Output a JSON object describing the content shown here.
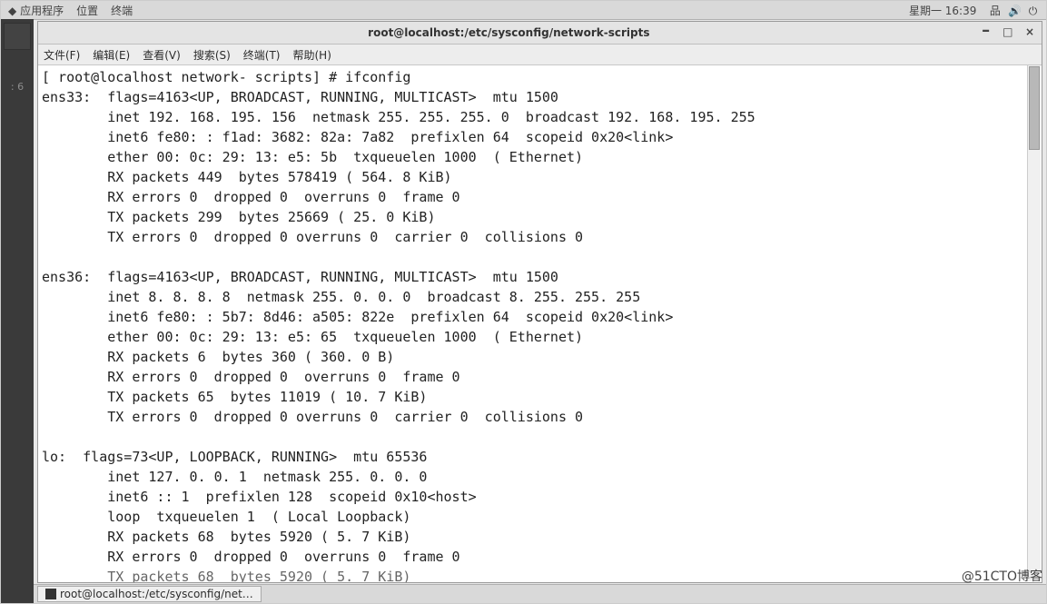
{
  "top_panel": {
    "apps": "应用程序",
    "places": "位置",
    "terminal": "终端",
    "clock": "星期一 16:39"
  },
  "left_clock": ": 6",
  "window": {
    "title": "root@localhost:/etc/sysconfig/network-scripts",
    "btn_min": "–",
    "btn_max": "□",
    "btn_close": "×"
  },
  "menubar": {
    "file": "文件(F)",
    "edit": "编辑(E)",
    "view": "查看(V)",
    "search": "搜索(S)",
    "terminal": "终端(T)",
    "help": "帮助(H)"
  },
  "term": {
    "l01": "[ root@localhost network- scripts] # ifconfig",
    "l02": "ens33:  flags=4163<UP, BROADCAST, RUNNING, MULTICAST>  mtu 1500",
    "l03": "        inet 192. 168. 195. 156  netmask 255. 255. 255. 0  broadcast 192. 168. 195. 255",
    "l04": "        inet6 fe80: : f1ad: 3682: 82a: 7a82  prefixlen 64  scopeid 0x20<link>",
    "l05": "        ether 00: 0c: 29: 13: e5: 5b  txqueuelen 1000  ( Ethernet)",
    "l06": "        RX packets 449  bytes 578419 ( 564. 8 KiB)",
    "l07": "        RX errors 0  dropped 0  overruns 0  frame 0",
    "l08": "        TX packets 299  bytes 25669 ( 25. 0 KiB)",
    "l09": "        TX errors 0  dropped 0 overruns 0  carrier 0  collisions 0",
    "l10": "",
    "l11": "ens36:  flags=4163<UP, BROADCAST, RUNNING, MULTICAST>  mtu 1500",
    "l12": "        inet 8. 8. 8. 8  netmask 255. 0. 0. 0  broadcast 8. 255. 255. 255",
    "l13": "        inet6 fe80: : 5b7: 8d46: a505: 822e  prefixlen 64  scopeid 0x20<link>",
    "l14": "        ether 00: 0c: 29: 13: e5: 65  txqueuelen 1000  ( Ethernet)",
    "l15": "        RX packets 6  bytes 360 ( 360. 0 B)",
    "l16": "        RX errors 0  dropped 0  overruns 0  frame 0",
    "l17": "        TX packets 65  bytes 11019 ( 10. 7 KiB)",
    "l18": "        TX errors 0  dropped 0 overruns 0  carrier 0  collisions 0",
    "l19": "",
    "l20": "lo:  flags=73<UP, LOOPBACK, RUNNING>  mtu 65536",
    "l21": "        inet 127. 0. 0. 1  netmask 255. 0. 0. 0",
    "l22": "        inet6 :: 1  prefixlen 128  scopeid 0x10<host>",
    "l23": "        loop  txqueuelen 1  ( Local Loopback)",
    "l24": "        RX packets 68  bytes 5920 ( 5. 7 KiB)",
    "l25": "        RX errors 0  dropped 0  overruns 0  frame 0",
    "l26": "        TX packets 68  bytes 5920 ( 5. 7 KiB)"
  },
  "taskbar": {
    "item1": "root@localhost:/etc/sysconfig/net…"
  },
  "watermark": "@51CTO博客"
}
